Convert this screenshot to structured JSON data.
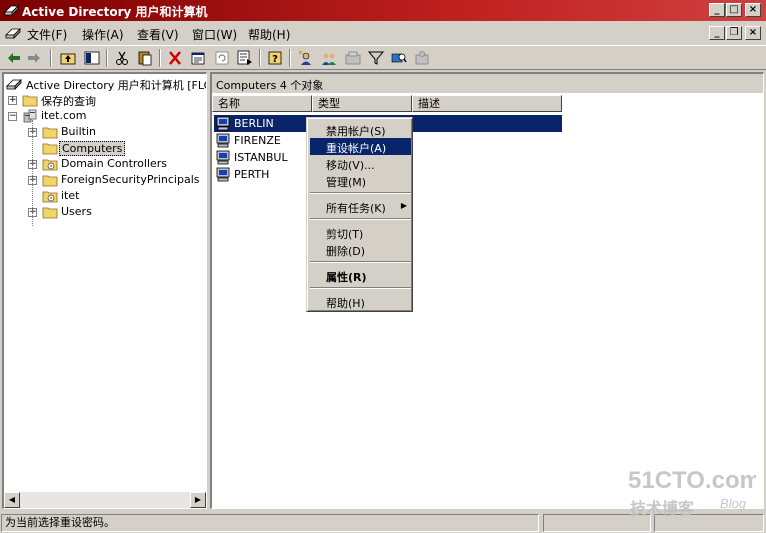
{
  "window": {
    "title": "Active Directory 用户和计算机",
    "min_glyph": "_",
    "max_glyph": "□",
    "close_glyph": "×"
  },
  "menubar": {
    "items": [
      "文件(F)",
      "操作(A)",
      "查看(V)",
      "窗口(W)",
      "帮助(H)"
    ],
    "mdi": {
      "min": "_",
      "restore": "❐",
      "close": "×"
    }
  },
  "toolbar": {
    "icons": [
      "back-arrow-icon",
      "forward-arrow-icon",
      "up-folder-icon",
      "show-tree-icon",
      "cut-icon",
      "paste-icon",
      "delete-icon",
      "properties-icon",
      "refresh-icon",
      "export-list-icon",
      "help-icon",
      "new-user-icon",
      "new-group-icon",
      "new-ou-icon",
      "filter-icon",
      "find-icon",
      "add-to-group-icon"
    ]
  },
  "tree": {
    "root_label": "Active Directory 用户和计算机 [FLOR",
    "items": [
      {
        "label": "保存的查询",
        "level": 1,
        "expander": "+"
      },
      {
        "label": "itet.com",
        "level": 1,
        "expander": "−"
      },
      {
        "label": "Builtin",
        "level": 2,
        "expander": "+"
      },
      {
        "label": "Computers",
        "level": 2,
        "expander": "",
        "selected": true
      },
      {
        "label": "Domain Controllers",
        "level": 2,
        "expander": "+"
      },
      {
        "label": "ForeignSecurityPrincipals",
        "level": 2,
        "expander": "+"
      },
      {
        "label": "itet",
        "level": 2,
        "expander": ""
      },
      {
        "label": "Users",
        "level": 2,
        "expander": "+"
      }
    ]
  },
  "list": {
    "header": "Computers    4 个对象",
    "columns": [
      "名称",
      "类型",
      "描述"
    ],
    "rows": [
      {
        "name": "BERLIN",
        "selected": true
      },
      {
        "name": "FIRENZE"
      },
      {
        "name": "ISTANBUL"
      },
      {
        "name": "PERTH"
      }
    ]
  },
  "context_menu": {
    "groups": [
      [
        {
          "label": "禁用帐户(S)"
        },
        {
          "label": "重设帐户(A)",
          "highlighted": true
        },
        {
          "label": "移动(V)..."
        },
        {
          "label": "管理(M)"
        }
      ],
      [
        {
          "label": "所有任务(K)",
          "submenu": true
        }
      ],
      [
        {
          "label": "剪切(T)"
        },
        {
          "label": "删除(D)"
        }
      ],
      [
        {
          "label": "属性(R)",
          "bold": true
        }
      ],
      [
        {
          "label": "帮助(H)"
        }
      ]
    ]
  },
  "statusbar": {
    "text": "为当前选择重设密码。"
  },
  "watermark": {
    "main": "51CTO.com",
    "sub": "技术博客",
    "tag": "Blog"
  }
}
